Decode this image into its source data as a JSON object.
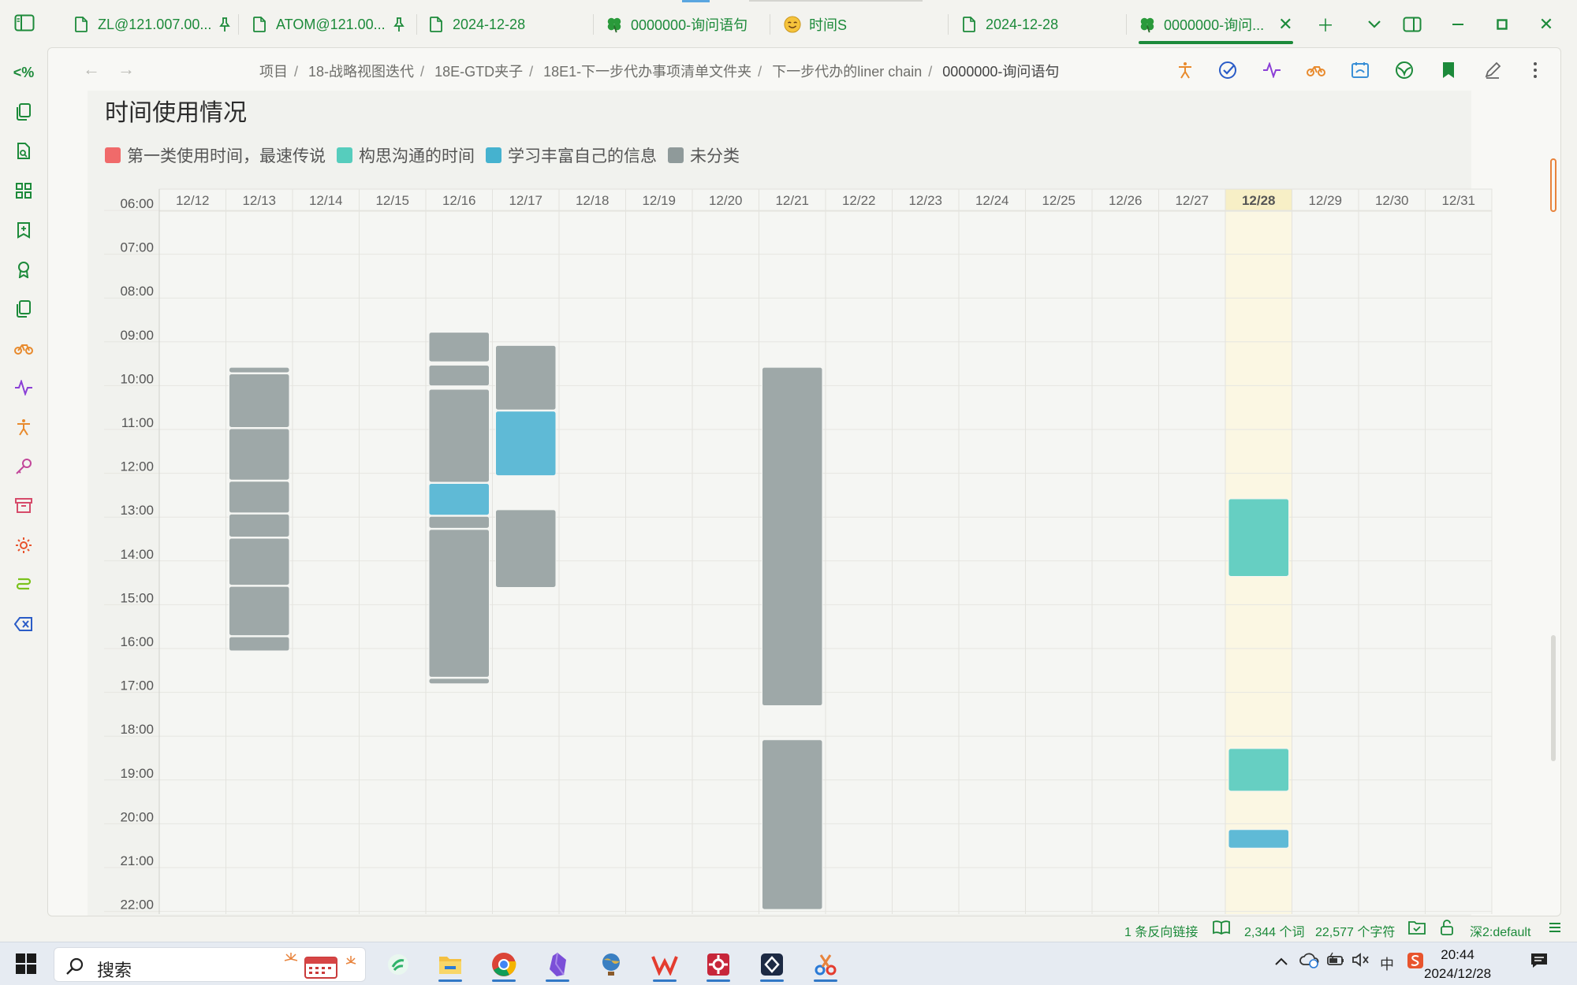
{
  "tabs": [
    {
      "label": "ZL@121.007.00...",
      "icon": "file-icon",
      "pinned": true
    },
    {
      "label": "ATOM@121.00...",
      "icon": "file-icon",
      "pinned": true
    },
    {
      "label": "2024-12-28",
      "icon": "file-icon",
      "pinned": false
    },
    {
      "label": "0000000-询问语句",
      "icon": "clover-icon",
      "pinned": false
    },
    {
      "label": "时间S",
      "icon": "smile-face-icon",
      "pinned": false
    },
    {
      "label": "2024-12-28",
      "icon": "file-icon",
      "pinned": false
    },
    {
      "label": "0000000-询问...",
      "icon": "clover-icon",
      "pinned": false,
      "active": true
    }
  ],
  "ribbon": {
    "code_label": "<%"
  },
  "breadcrumb": [
    "项目",
    "18-战略视图迭代",
    "18E-GTD夹子",
    "18E1-下一步代办事项清单文件夹",
    "下一步代办的liner chain",
    "0000000-询问语句"
  ],
  "page": {
    "title": "时间使用情况"
  },
  "legend": [
    {
      "label": "第一类使用时间，最速传说",
      "color": "#f06a6a"
    },
    {
      "label": "构思沟通的时间",
      "color": "#56cdbd"
    },
    {
      "label": "学习丰富自己的信息",
      "color": "#45b2cf"
    },
    {
      "label": "未分类",
      "color": "#8f9a9a"
    }
  ],
  "chart_data": {
    "type": "heatmap",
    "days": [
      "12/12",
      "12/13",
      "12/14",
      "12/15",
      "12/16",
      "12/17",
      "12/18",
      "12/19",
      "12/20",
      "12/21",
      "12/22",
      "12/23",
      "12/24",
      "12/25",
      "12/26",
      "12/27",
      "12/28",
      "12/29",
      "12/30",
      "12/31"
    ],
    "hours": [
      "06:00",
      "07:00",
      "08:00",
      "09:00",
      "10:00",
      "11:00",
      "12:00",
      "13:00",
      "14:00",
      "15:00",
      "16:00",
      "17:00",
      "18:00",
      "19:00",
      "20:00",
      "21:00",
      "22:00"
    ],
    "highlight_day": "12/28",
    "events": [
      {
        "day": "12/13",
        "start": 9.6,
        "end": 9.75,
        "category": "未分类"
      },
      {
        "day": "12/13",
        "start": 9.75,
        "end": 11.0,
        "category": "未分类"
      },
      {
        "day": "12/13",
        "start": 11.0,
        "end": 12.2,
        "category": "未分类"
      },
      {
        "day": "12/13",
        "start": 12.2,
        "end": 12.95,
        "category": "未分类"
      },
      {
        "day": "12/13",
        "start": 12.95,
        "end": 13.5,
        "category": "未分类"
      },
      {
        "day": "12/13",
        "start": 13.5,
        "end": 14.6,
        "category": "未分类"
      },
      {
        "day": "12/13",
        "start": 14.6,
        "end": 15.75,
        "category": "未分类"
      },
      {
        "day": "12/13",
        "start": 15.75,
        "end": 16.1,
        "category": "未分类"
      },
      {
        "day": "12/16",
        "start": 8.8,
        "end": 9.5,
        "category": "未分类"
      },
      {
        "day": "12/16",
        "start": 9.55,
        "end": 10.05,
        "category": "未分类"
      },
      {
        "day": "12/16",
        "start": 10.1,
        "end": 12.25,
        "category": "未分类"
      },
      {
        "day": "12/16",
        "start": 12.25,
        "end": 13.0,
        "category": "学习丰富自己的信息"
      },
      {
        "day": "12/16",
        "start": 13.0,
        "end": 13.3,
        "category": "未分类"
      },
      {
        "day": "12/16",
        "start": 13.3,
        "end": 16.7,
        "category": "未分类"
      },
      {
        "day": "12/16",
        "start": 16.7,
        "end": 16.85,
        "category": "未分类"
      },
      {
        "day": "12/17",
        "start": 9.1,
        "end": 10.6,
        "category": "未分类"
      },
      {
        "day": "12/17",
        "start": 10.6,
        "end": 12.1,
        "category": "学习丰富自己的信息"
      },
      {
        "day": "12/17",
        "start": 12.85,
        "end": 14.65,
        "category": "未分类"
      },
      {
        "day": "12/21",
        "start": 9.6,
        "end": 17.35,
        "category": "未分类"
      },
      {
        "day": "12/21",
        "start": 18.1,
        "end": 22.0,
        "category": "未分类"
      },
      {
        "day": "12/28",
        "start": 12.6,
        "end": 14.4,
        "category": "构思沟通的时间"
      },
      {
        "day": "12/28",
        "start": 18.3,
        "end": 19.3,
        "category": "构思沟通的时间"
      },
      {
        "day": "12/28",
        "start": 20.15,
        "end": 20.6,
        "category": "学习丰富自己的信息"
      }
    ]
  },
  "status": {
    "backlinks": "1 条反向链接",
    "words": "2,344 个词",
    "chars": "22,577 个字符",
    "theme": "深2:default"
  },
  "taskbar": {
    "search_label": "搜索",
    "time": "20:44",
    "date": "2024/12/28",
    "ime": "中"
  }
}
